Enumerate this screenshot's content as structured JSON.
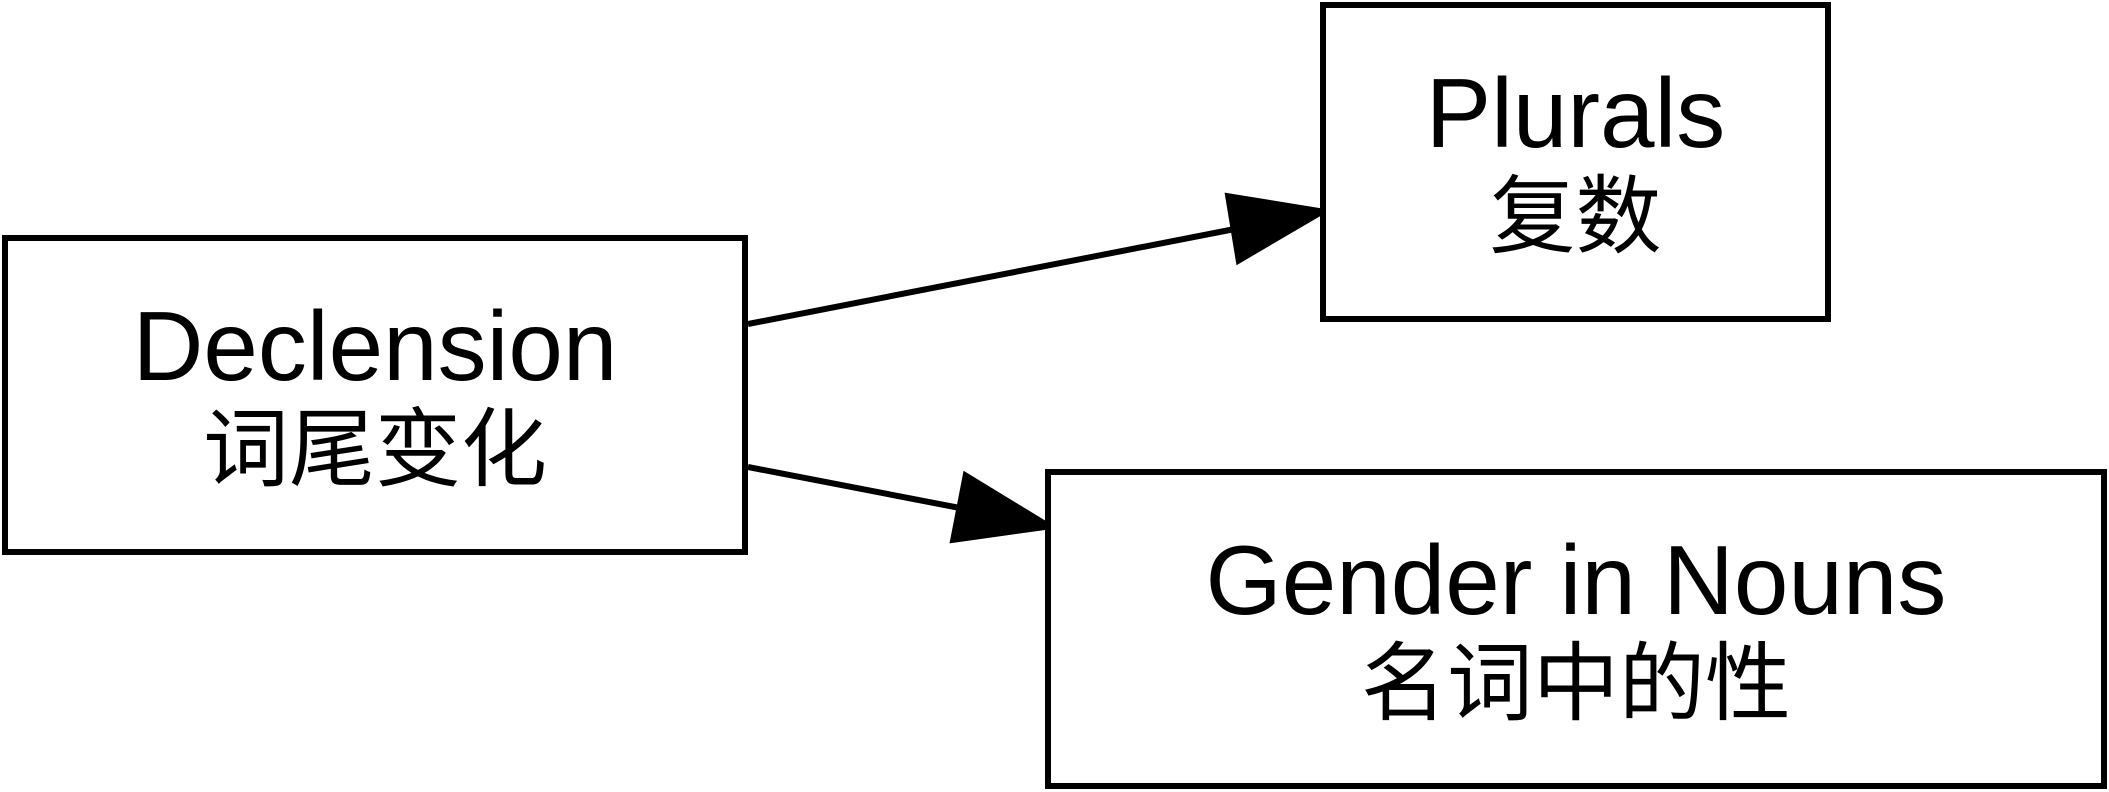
{
  "diagram": {
    "nodes": {
      "declension": {
        "en": "Declension",
        "zh": "词尾变化"
      },
      "plurals": {
        "en": "Plurals",
        "zh": "复数"
      },
      "gender": {
        "en": "Gender in Nouns",
        "zh": "名词中的性"
      }
    },
    "edges": [
      {
        "from": "declension",
        "to": "plurals"
      },
      {
        "from": "declension",
        "to": "gender"
      }
    ]
  }
}
